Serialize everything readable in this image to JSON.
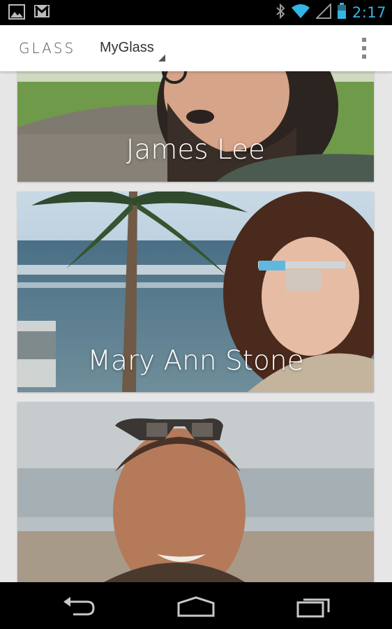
{
  "status_bar": {
    "time": "2:17",
    "icons": [
      "gallery-icon",
      "gmail-icon",
      "bluetooth-icon",
      "wifi-icon",
      "cell-signal-icon",
      "battery-icon"
    ]
  },
  "app_bar": {
    "logo": "GLASS",
    "title": "MyGlass",
    "menu_icon": "overflow-menu-icon"
  },
  "cards": [
    {
      "name": "James Lee"
    },
    {
      "name": "Mary Ann Stone"
    },
    {
      "name": ""
    }
  ],
  "nav_bar": {
    "icons": [
      "back-icon",
      "home-icon",
      "recent-apps-icon"
    ]
  },
  "colors": {
    "accent": "#33b5e5",
    "status_bar_bg": "#000000",
    "app_bar_bg": "#ffffff",
    "content_bg": "#e6e6e6"
  }
}
